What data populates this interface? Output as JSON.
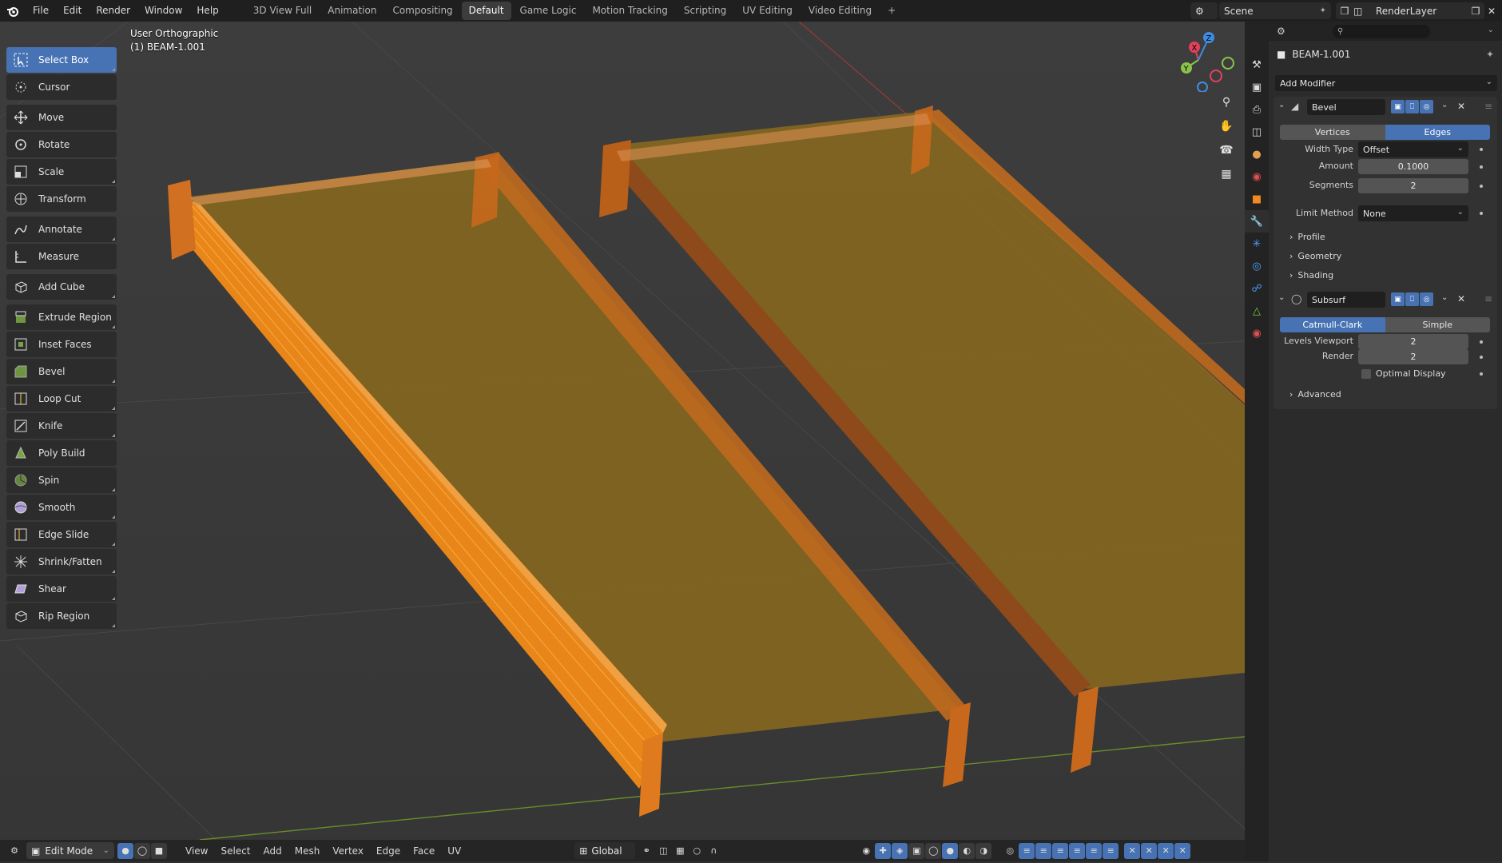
{
  "topbar": {
    "menus": [
      "File",
      "Edit",
      "Render",
      "Window",
      "Help"
    ],
    "workspaces": [
      "3D View Full",
      "Animation",
      "Compositing",
      "Default",
      "Game Logic",
      "Motion Tracking",
      "Scripting",
      "UV Editing",
      "Video Editing"
    ],
    "active_workspace": "Default",
    "add_workspace": "+",
    "scene": "Scene",
    "view_layer": "RenderLayer"
  },
  "viewport": {
    "view_name": "User Orthographic",
    "object_info": "(1) BEAM-1.001"
  },
  "toolbar": {
    "tools": [
      "Select Box",
      "Cursor",
      "Move",
      "Rotate",
      "Scale",
      "Transform",
      "Annotate",
      "Measure",
      "Add Cube",
      "Extrude Region",
      "Inset Faces",
      "Bevel",
      "Loop Cut",
      "Knife",
      "Poly Build",
      "Spin",
      "Smooth",
      "Edge Slide",
      "Shrink/Fatten",
      "Shear",
      "Rip Region"
    ],
    "active": "Select Box"
  },
  "vp_header": {
    "mode": "Edit Mode",
    "menus": [
      "View",
      "Select",
      "Add",
      "Mesh",
      "Vertex",
      "Edge",
      "Face",
      "UV"
    ],
    "orientation": "Global"
  },
  "properties": {
    "object_name": "BEAM-1.001",
    "add_modifier": "Add Modifier",
    "bevel": {
      "name": "Bevel",
      "affect_options": [
        "Vertices",
        "Edges"
      ],
      "affect_active": "Edges",
      "width_type_label": "Width Type",
      "width_type": "Offset",
      "amount_label": "Amount",
      "amount": "0.1000",
      "segments_label": "Segments",
      "segments": "2",
      "limit_method_label": "Limit Method",
      "limit_method": "None",
      "subpanels": [
        "Profile",
        "Geometry",
        "Shading"
      ]
    },
    "subsurf": {
      "name": "Subsurf",
      "type_options": [
        "Catmull-Clark",
        "Simple"
      ],
      "type_active": "Catmull-Clark",
      "levels_viewport_label": "Levels Viewport",
      "levels_viewport": "2",
      "render_label": "Render",
      "render": "2",
      "optimal_display_label": "Optimal Display",
      "subpanels": [
        "Advanced"
      ]
    }
  },
  "colors": {
    "accent": "#4772b3",
    "mesh_orange": "#e8861a",
    "gizmo_x": "#e0425c",
    "gizmo_y": "#8bc34a",
    "gizmo_z": "#3d8ee0"
  }
}
